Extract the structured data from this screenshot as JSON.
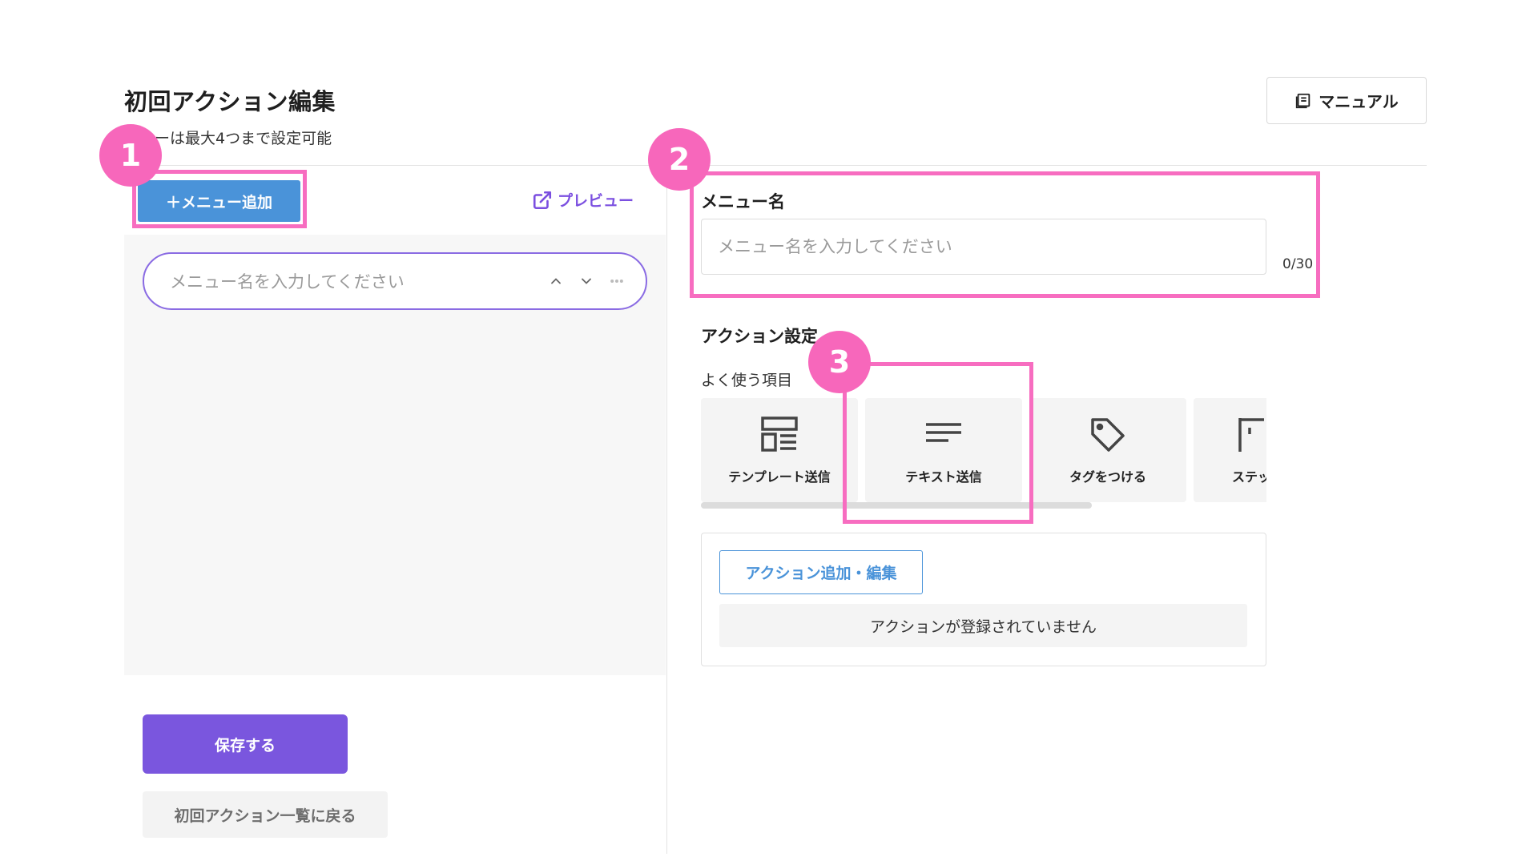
{
  "header": {
    "title": "初回アクション編集",
    "subtitle": "ニューは最大4つまで設定可能",
    "manual_button": "マニュアル"
  },
  "left": {
    "add_menu_button": "＋メニュー追加",
    "preview_link": "プレビュー",
    "menu_item_placeholder": "メニュー名を入力してください",
    "save_button": "保存する",
    "back_button": "初回アクション一覧に戻る"
  },
  "right": {
    "menu_name_label": "メニュー名",
    "menu_name_value": "",
    "menu_name_placeholder": "メニュー名を入力してください",
    "char_count": "0/30",
    "action_settings_label": "アクション設定",
    "frequent_label": "よく使う項目",
    "action_cards": [
      {
        "label": "テンプレート送信",
        "icon": "template-icon"
      },
      {
        "label": "テキスト送信",
        "icon": "text-lines-icon"
      },
      {
        "label": "タグをつける",
        "icon": "tag-icon"
      },
      {
        "label": "ステッ",
        "icon": "step-icon"
      }
    ],
    "action_edit_button": "アクション追加・編集",
    "no_action_message": "アクションが登録されていません"
  },
  "callouts": [
    "1",
    "2",
    "3"
  ],
  "colors": {
    "primary_blue": "#4a93d9",
    "primary_purple": "#7a56de",
    "callout_pink": "#f767bb"
  }
}
